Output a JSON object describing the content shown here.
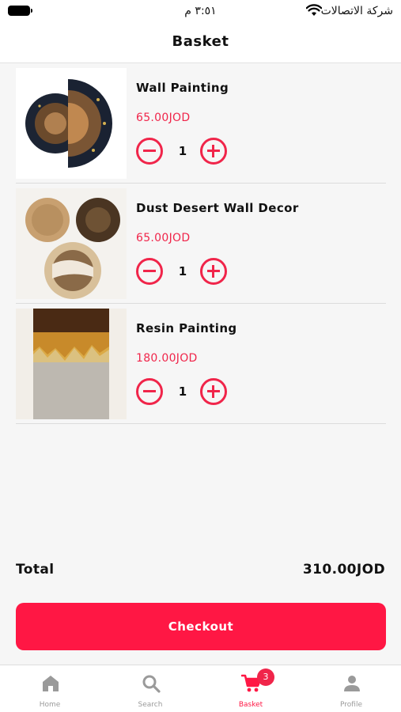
{
  "status_bar": {
    "time": "٣:٥١ م",
    "carrier": "شركة الاتصالات"
  },
  "header": {
    "title": "Basket"
  },
  "items": [
    {
      "name": "Wall Painting",
      "price": "65.00JOD",
      "quantity": "1",
      "image_icon": "wall-painting-image"
    },
    {
      "name": "Dust Desert Wall Decor",
      "price": "65.00JOD",
      "quantity": "1",
      "image_icon": "wall-decor-image"
    },
    {
      "name": "Resin Painting",
      "price": "180.00JOD",
      "quantity": "1",
      "image_icon": "resin-painting-image"
    }
  ],
  "summary": {
    "total_label": "Total",
    "total_value": "310.00JOD"
  },
  "checkout": {
    "label": "Checkout"
  },
  "tabbar": {
    "tabs": [
      {
        "label": "Home",
        "icon": "home-icon"
      },
      {
        "label": "Search",
        "icon": "search-icon"
      },
      {
        "label": "Basket",
        "icon": "cart-icon",
        "badge": "3",
        "active": true
      },
      {
        "label": "Profile",
        "icon": "profile-icon"
      }
    ]
  },
  "colors": {
    "accent": "#ff1744",
    "price": "#f0254a",
    "inactive": "#9a9a9a",
    "background": "#f6f6f6"
  }
}
